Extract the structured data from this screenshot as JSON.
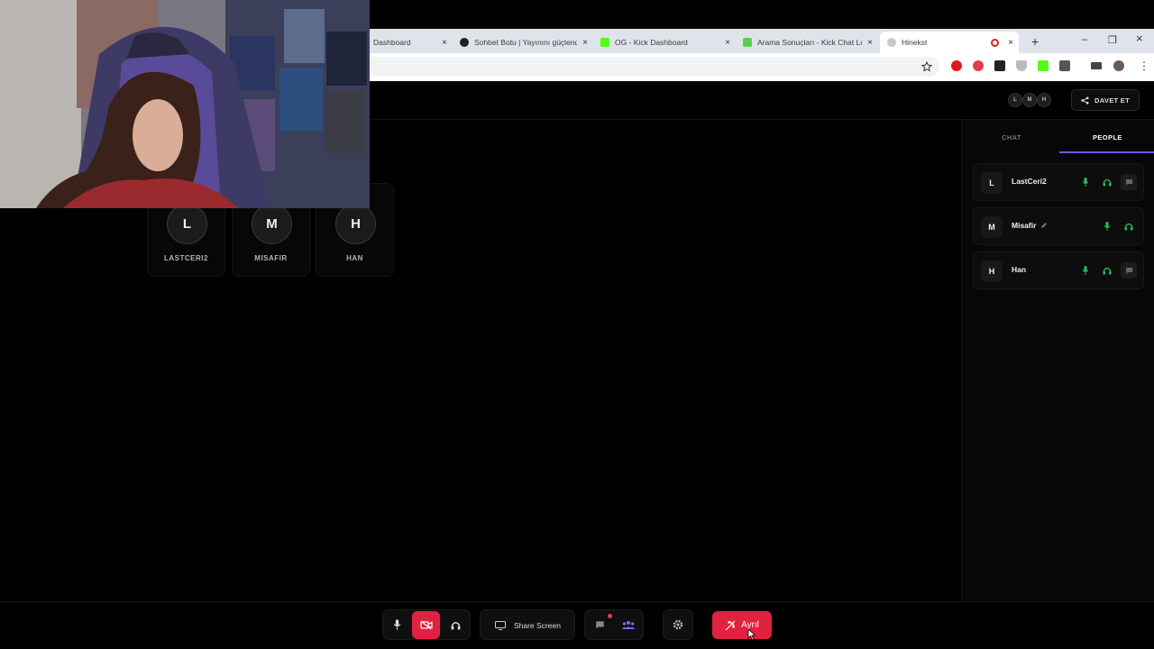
{
  "browser": {
    "tabs": [
      {
        "title": "Dashboard",
        "favicon": "dashboard-favicon-icon",
        "active": false
      },
      {
        "title": "Sohbet Botu | Yayınını güçlendi",
        "favicon": "github-favicon-icon",
        "active": false
      },
      {
        "title": "OG - Kick Dashboard",
        "favicon": "kick-favicon-icon",
        "active": false
      },
      {
        "title": "Arama Sonuçları - Kick Chat Lo",
        "favicon": "kick-chat-favicon-icon",
        "active": false
      },
      {
        "title": "Hinekst",
        "favicon": "hinekst-favicon-icon",
        "active": true
      }
    ],
    "new_tab": "+",
    "close_glyph": "×",
    "window_controls": {
      "minimize": "–",
      "maximize": "❐",
      "close": "×"
    }
  },
  "header": {
    "participant_initials": [
      "L",
      "M",
      "H"
    ],
    "invite_label": "DAVET ET"
  },
  "tiles": [
    {
      "initial": "L",
      "name": "LASTCERI2"
    },
    {
      "initial": "M",
      "name": "MISAFIR"
    },
    {
      "initial": "H",
      "name": "HAN"
    }
  ],
  "side_panel": {
    "tabs": [
      {
        "label": "CHAT",
        "active": false
      },
      {
        "label": "PEOPLE",
        "active": true
      }
    ],
    "people": [
      {
        "initial": "L",
        "name": "LastCeri2",
        "has_chat": true,
        "edit": false
      },
      {
        "initial": "M",
        "name": "Misafir",
        "has_chat": false,
        "edit": true
      },
      {
        "initial": "H",
        "name": "Han",
        "has_chat": true,
        "edit": false
      }
    ]
  },
  "controls": {
    "share_screen_label": "Share Screen",
    "leave_label": "Ayrıl",
    "camera_off": true,
    "chat_unread": true
  },
  "colors": {
    "accent": "#6b5cff",
    "danger": "#e0213f",
    "mic_green": "#22c55e",
    "people_purple": "#7c6dff"
  }
}
